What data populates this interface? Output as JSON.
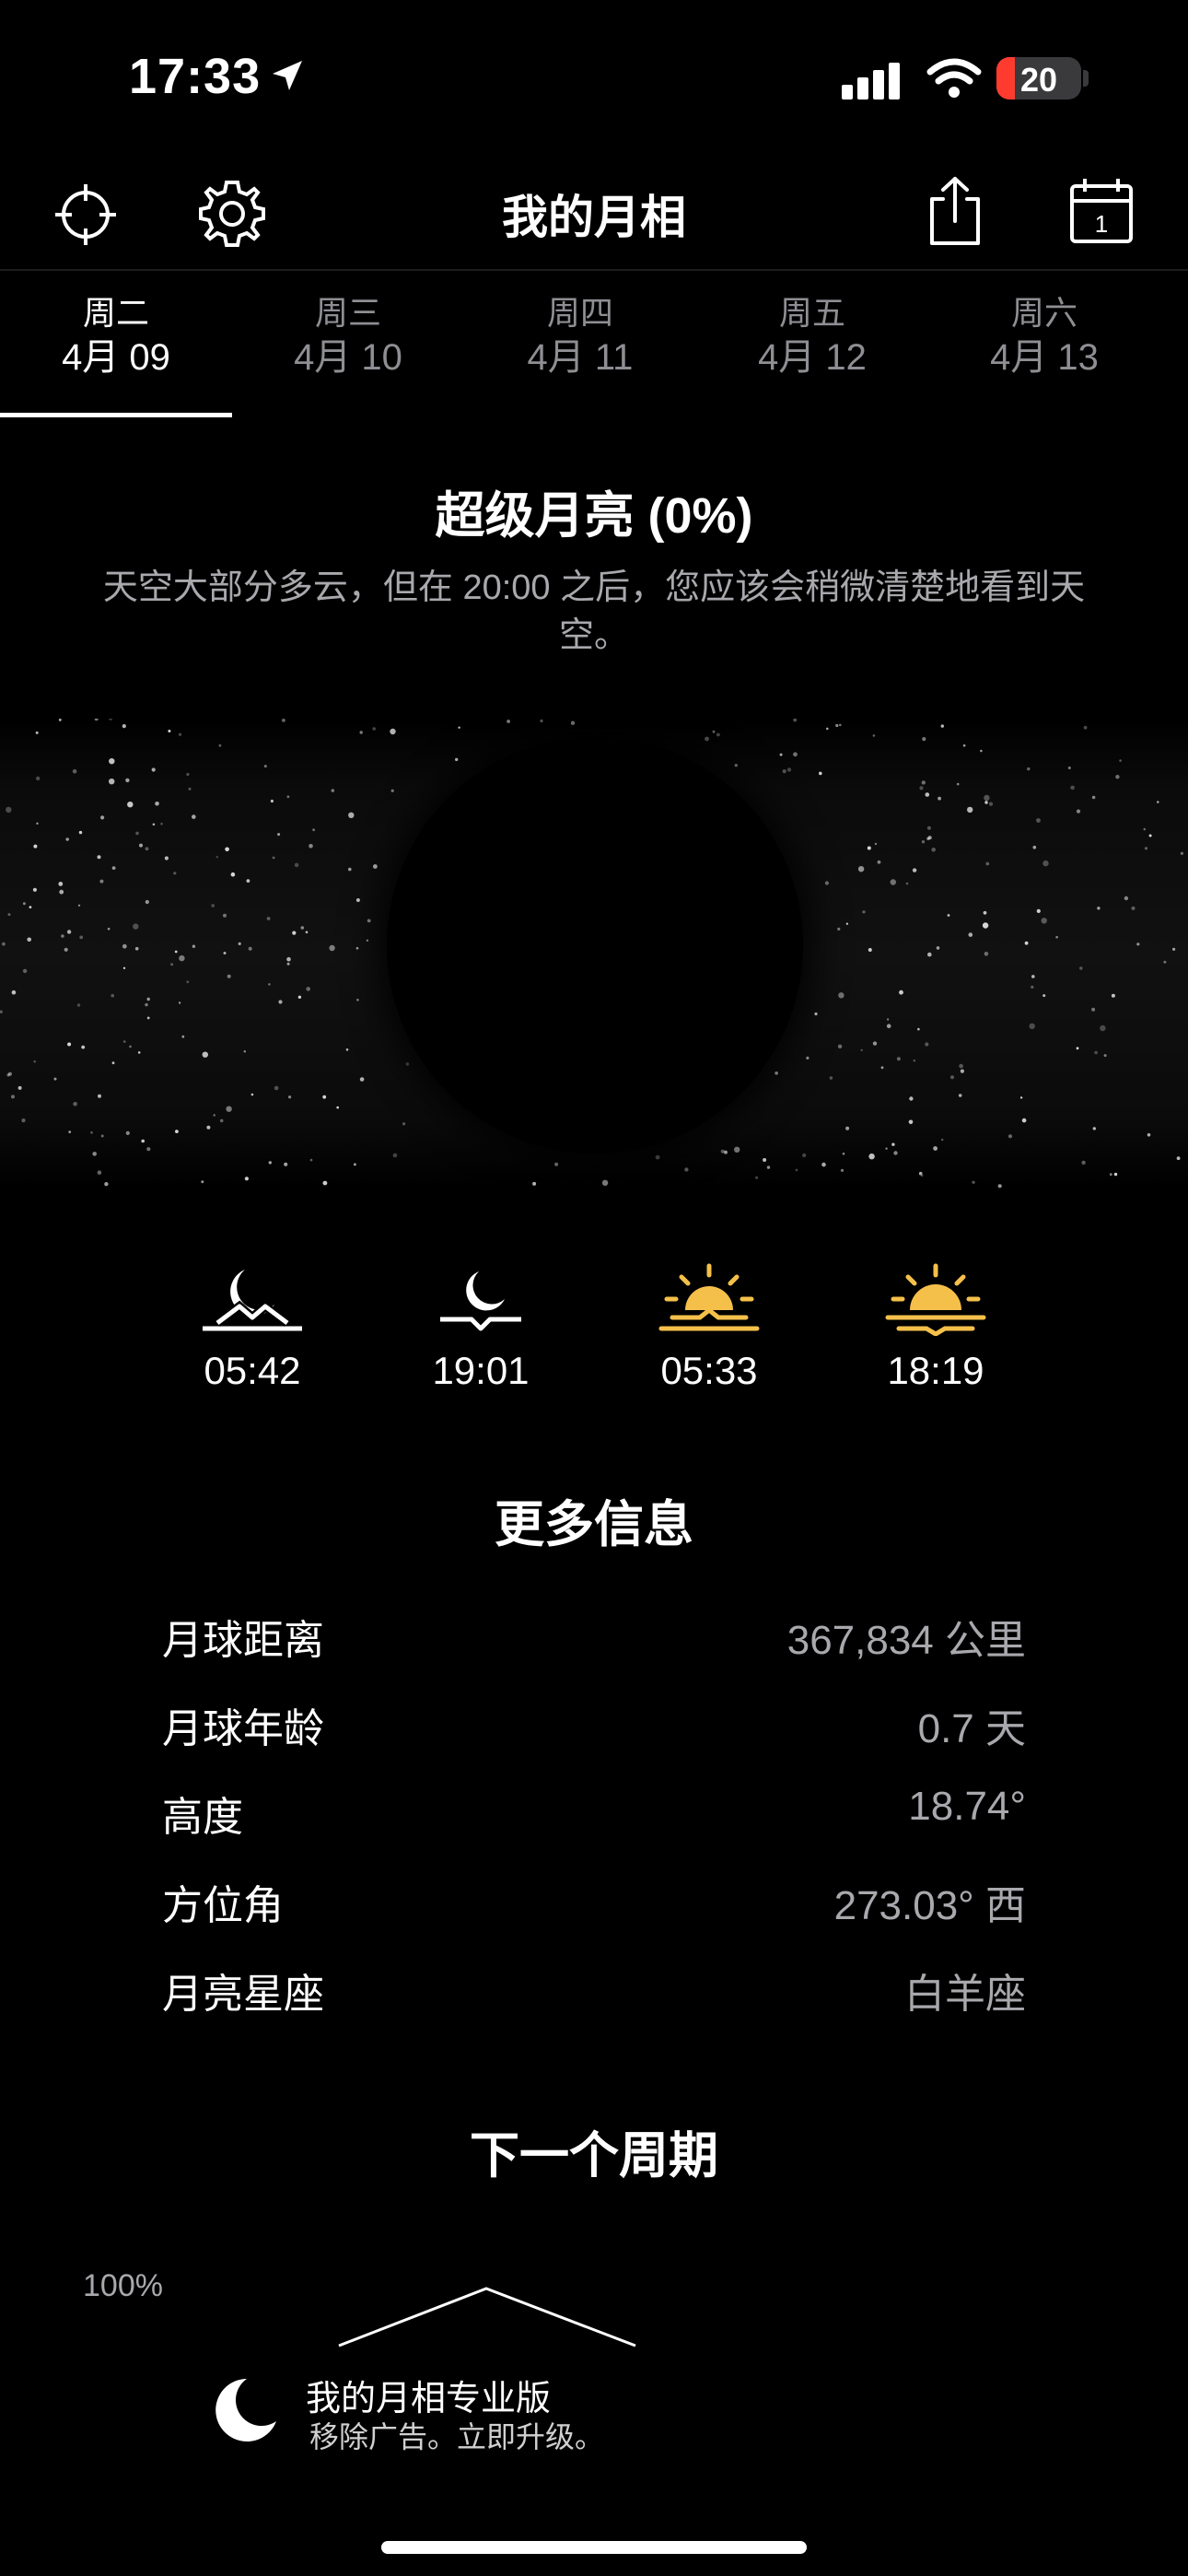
{
  "status_bar": {
    "time": "17:33",
    "battery": "20"
  },
  "nav": {
    "title": "我的月相"
  },
  "tabs": [
    {
      "day": "周二",
      "date": "4月 09"
    },
    {
      "day": "周三",
      "date": "4月 10"
    },
    {
      "day": "周四",
      "date": "4月 11"
    },
    {
      "day": "周五",
      "date": "4月 12"
    },
    {
      "day": "周六",
      "date": "4月 13"
    }
  ],
  "phase": {
    "title": "超级月亮 (0%)",
    "description": "天空大部分多云，但在 20:00 之后，您应该会稍微清楚地看到天空。"
  },
  "events": [
    {
      "time": "05:42",
      "icon": "moonrise-icon",
      "color": "#ffffff"
    },
    {
      "time": "19:01",
      "icon": "moonset-icon",
      "color": "#ffffff"
    },
    {
      "time": "05:33",
      "icon": "sunrise-icon",
      "color": "#f5c04a"
    },
    {
      "time": "18:19",
      "icon": "sunset-icon",
      "color": "#f5c04a"
    }
  ],
  "more_info": {
    "title": "更多信息",
    "rows": [
      {
        "label": "月球距离",
        "value": "367,834 公里"
      },
      {
        "label": "月球年龄",
        "value": "0.7 天"
      },
      {
        "label": "高度",
        "value": "18.74°"
      },
      {
        "label": "方位角",
        "value": "273.03° 西"
      },
      {
        "label": "月亮星座",
        "value": "白羊座"
      }
    ]
  },
  "next_cycle": {
    "title": "下一个周期",
    "y_label": "100%"
  },
  "promo": {
    "title": "我的月相专业版",
    "subtitle": "移除广告。立即升级。"
  },
  "colors": {
    "accent_sun": "#f5c04a",
    "muted_text": "#a8a8ad"
  }
}
